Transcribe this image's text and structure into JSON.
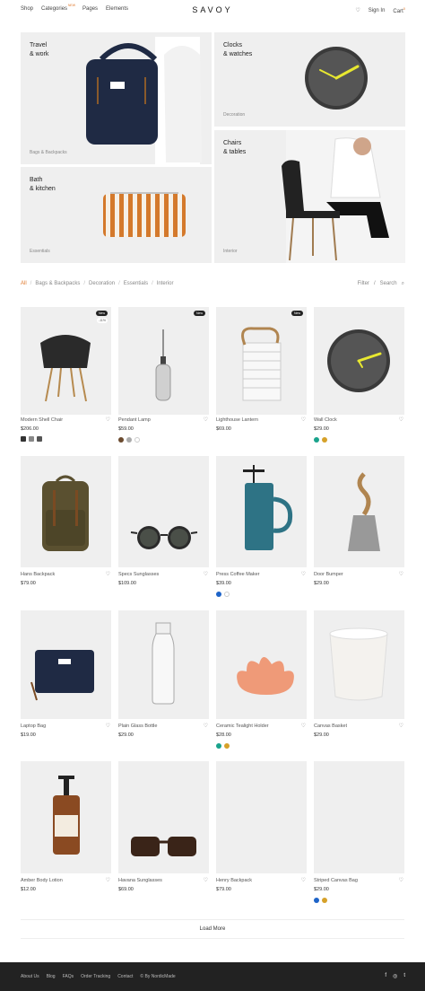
{
  "header": {
    "nav": [
      "Shop",
      "Categories",
      "Pages",
      "Elements"
    ],
    "new_badge": "NEW",
    "logo": "SAVOY",
    "sign_in": "Sign In",
    "cart": "Cart",
    "cart_count": "0"
  },
  "hero": [
    {
      "title": "Travel\n& work",
      "caption": "Bags & Backpacks"
    },
    {
      "title": "Clocks\n& watches",
      "caption": "Decoration"
    },
    {
      "title": "Bath\n& kitchen",
      "caption": "Essentials"
    },
    {
      "title": "Chairs\n& tables",
      "caption": "Interior"
    }
  ],
  "filter": {
    "cats": [
      "All",
      "Bags & Backpacks",
      "Decoration",
      "Essentials",
      "Interior"
    ],
    "filter_label": "Filter",
    "search_label": "Search"
  },
  "products": [
    {
      "name": "Modern Shell Chair",
      "price": "$206.00",
      "badge": "New",
      "sale": "-11%"
    },
    {
      "name": "Pendant Lamp",
      "price": "$59.00",
      "badge": "New"
    },
    {
      "name": "Lighthouse Lantern",
      "price": "$69.00",
      "badge": "New"
    },
    {
      "name": "Wall Clock",
      "price": "$29.00"
    },
    {
      "name": "Hans Backpack",
      "price": "$79.00"
    },
    {
      "name": "Specs Sunglasses",
      "price": "$109.00"
    },
    {
      "name": "Press Coffee Maker",
      "price": "$39.00"
    },
    {
      "name": "Door Bumper",
      "price": "$29.00"
    },
    {
      "name": "Laptop Bag",
      "price": "$19.00"
    },
    {
      "name": "Plain Glass Bottle",
      "price": "$29.00"
    },
    {
      "name": "Ceramic Tealight Holder",
      "price": "$28.00"
    },
    {
      "name": "Canvas Basket",
      "price": "$29.00"
    },
    {
      "name": "Amber Body Lotion",
      "price": "$12.00"
    },
    {
      "name": "Havana Sunglasses",
      "price": "$69.00"
    },
    {
      "name": "Henry Backpack",
      "price": "$79.00"
    },
    {
      "name": "Striped Canvas Bag",
      "price": "$29.00"
    }
  ],
  "swatches": {
    "p2": [
      "#6b4a2e",
      "#aaaaaa",
      "#ffffff"
    ],
    "p4": [
      "#1aa38c",
      "#d6a12a"
    ],
    "p7": [
      "#1e64c8",
      "#ffffff"
    ],
    "p11": [
      "#1aa38c",
      "#d6a12a"
    ],
    "p16": [
      "#1e64c8",
      "#d6a12a"
    ]
  },
  "load_more": "Load More",
  "footer": {
    "links": [
      "About Us",
      "Blog",
      "FAQs",
      "Order Tracking",
      "Contact",
      "© By NordicMade"
    ],
    "social": [
      "f",
      "◎",
      "t"
    ]
  }
}
